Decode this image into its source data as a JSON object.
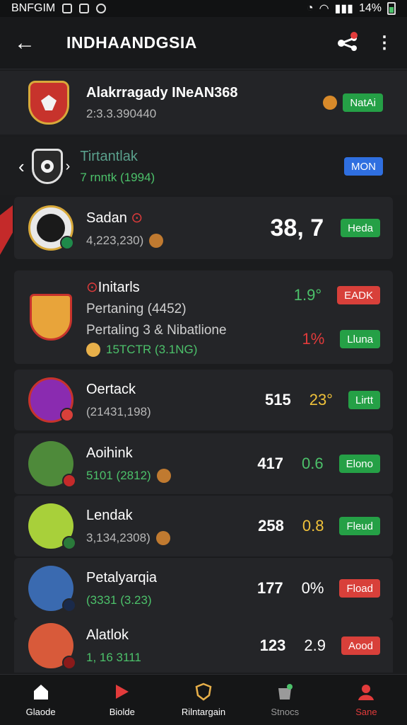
{
  "status": {
    "carrier": "BNFGIM",
    "battery": "14%"
  },
  "appbar": {
    "title": "INDHAANDGSIA",
    "back": "←",
    "more": "⋮"
  },
  "header1": {
    "name": "Alakrragady INeAN368",
    "sub": "2:3.3.390440",
    "badge": "NatAi"
  },
  "header2": {
    "name": "Tirtantlak",
    "sub": "7 rnntk (1994)",
    "badge": "MON"
  },
  "rows": [
    {
      "name": "Sadan",
      "sub": "4,223,230)",
      "stat": "38, 7",
      "stat2": "",
      "badge": "Heda",
      "badge_color": "green"
    },
    {
      "name": "Initarls",
      "line2": "Pertaning (4452)",
      "line3": "Pertaling 3 & Nibatlione",
      "sub": "15TCTR (3.1NG)",
      "stat": "1.9°",
      "stat2": "1%",
      "badge": "EADK",
      "badge2": "Lluna"
    },
    {
      "name": "Oertack",
      "sub": "(21431,198)",
      "stat": "515",
      "stat2": "23°",
      "badge": "Lirtt",
      "badge_color": "green"
    },
    {
      "name": "Aoihink",
      "sub": "5101 (2812)",
      "stat": "417",
      "stat2": "0.6",
      "badge": "Elono",
      "badge_color": "green"
    },
    {
      "name": "Lendak",
      "sub": "3,134,2308)",
      "stat": "258",
      "stat2": "0.8",
      "badge": "Fleud",
      "badge_color": "green"
    },
    {
      "name": "Petalyarqia",
      "sub": "(3331 (3.23)",
      "stat": "177",
      "stat2": "0%",
      "badge": "Fload",
      "badge_color": "red"
    },
    {
      "name": "Alatlok",
      "sub": "1, 16 3111",
      "stat": "123",
      "stat2": "2.9",
      "badge": "Aood",
      "badge_color": "red"
    }
  ],
  "nav": [
    {
      "label": "Glaode",
      "icon": "home-icon",
      "color": "#ffffff"
    },
    {
      "label": "Biolde",
      "icon": "play-icon",
      "color": "#e23b3b"
    },
    {
      "label": "Rilntargain",
      "icon": "shield-icon",
      "color": "#e8b04a"
    },
    {
      "label": "Stnocs",
      "icon": "shop-icon",
      "color": "#9a9a9a"
    },
    {
      "label": "Sane",
      "icon": "user-icon",
      "color": "#e23b3b"
    }
  ]
}
